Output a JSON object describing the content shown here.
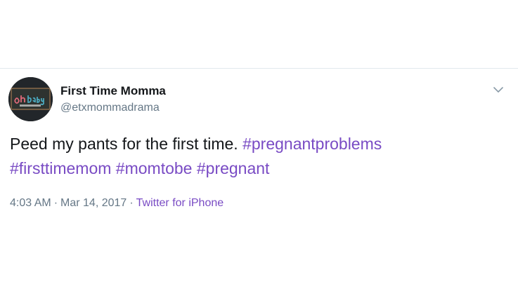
{
  "tweet": {
    "author": {
      "display_name": "First Time Momma",
      "handle": "@etxmommadrama",
      "avatar_text": "oh baby"
    },
    "text_plain": "Peed my pants for the first time.",
    "hashtags": [
      "#pregnantproblems",
      "#firsttimemom",
      "#momtobe",
      "#pregnant"
    ],
    "time": "4:03 AM",
    "separator": "·",
    "date": "Mar 14, 2017",
    "source": "Twitter for iPhone",
    "menu_icon": "chevron-down-icon"
  },
  "colors": {
    "hashtag": "#794bc4",
    "secondary_text": "#657786",
    "primary_text": "#14171a",
    "divider": "#e1e8ed"
  }
}
